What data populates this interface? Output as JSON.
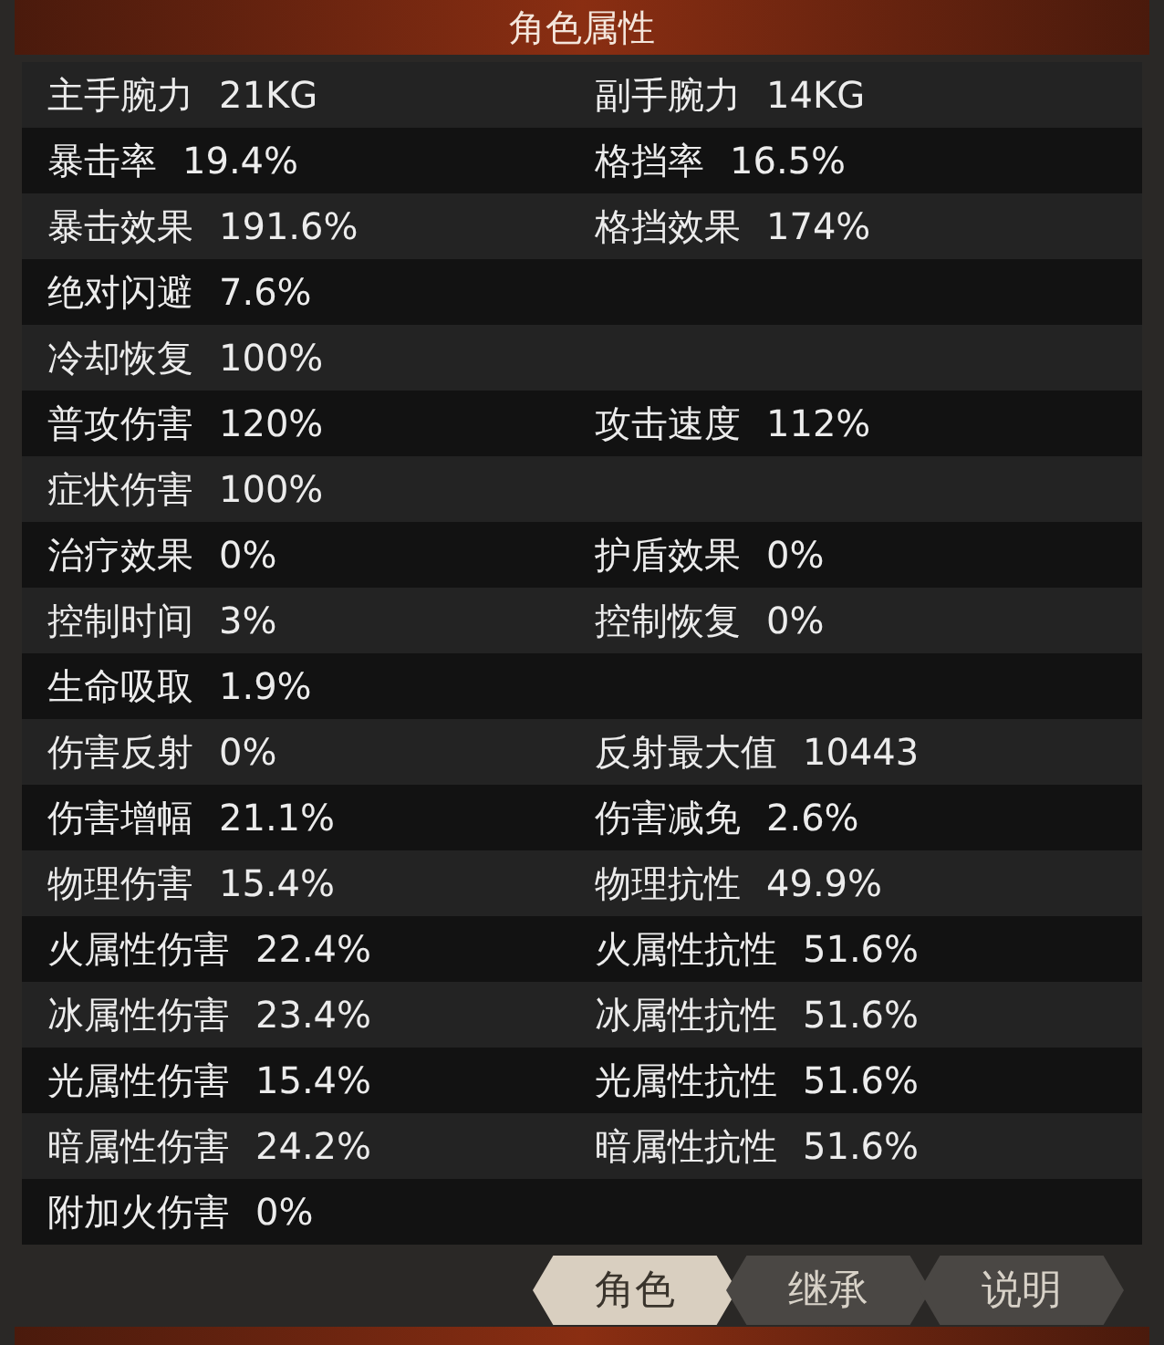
{
  "title": "角色属性",
  "rows": [
    {
      "left": {
        "label": "主手腕力",
        "value": "21KG"
      },
      "right": {
        "label": "副手腕力",
        "value": "14KG"
      }
    },
    {
      "left": {
        "label": "暴击率",
        "value": "19.4%"
      },
      "right": {
        "label": "格挡率",
        "value": "16.5%"
      }
    },
    {
      "left": {
        "label": "暴击效果",
        "value": "191.6%"
      },
      "right": {
        "label": "格挡效果",
        "value": "174%"
      }
    },
    {
      "left": {
        "label": "绝对闪避",
        "value": "7.6%"
      }
    },
    {
      "left": {
        "label": "冷却恢复",
        "value": "100%"
      }
    },
    {
      "left": {
        "label": "普攻伤害",
        "value": "120%"
      },
      "right": {
        "label": "攻击速度",
        "value": "112%"
      }
    },
    {
      "left": {
        "label": "症状伤害",
        "value": "100%"
      }
    },
    {
      "left": {
        "label": "治疗效果",
        "value": "0%"
      },
      "right": {
        "label": "护盾效果",
        "value": "0%"
      }
    },
    {
      "left": {
        "label": "控制时间",
        "value": "3%"
      },
      "right": {
        "label": "控制恢复",
        "value": "0%"
      }
    },
    {
      "left": {
        "label": "生命吸取",
        "value": "1.9%"
      }
    },
    {
      "left": {
        "label": "伤害反射",
        "value": "0%"
      },
      "right": {
        "label": "反射最大值",
        "value": "10443"
      }
    },
    {
      "left": {
        "label": "伤害增幅",
        "value": "21.1%"
      },
      "right": {
        "label": "伤害减免",
        "value": "2.6%"
      }
    },
    {
      "left": {
        "label": "物理伤害",
        "value": "15.4%"
      },
      "right": {
        "label": "物理抗性",
        "value": "49.9%"
      }
    },
    {
      "left": {
        "label": "火属性伤害",
        "value": "22.4%"
      },
      "right": {
        "label": "火属性抗性",
        "value": "51.6%"
      }
    },
    {
      "left": {
        "label": "冰属性伤害",
        "value": "23.4%"
      },
      "right": {
        "label": "冰属性抗性",
        "value": "51.6%"
      }
    },
    {
      "left": {
        "label": "光属性伤害",
        "value": "15.4%"
      },
      "right": {
        "label": "光属性抗性",
        "value": "51.6%"
      }
    },
    {
      "left": {
        "label": "暗属性伤害",
        "value": "24.2%"
      },
      "right": {
        "label": "暗属性抗性",
        "value": "51.6%"
      }
    },
    {
      "left": {
        "label": "附加火伤害",
        "value": "0%"
      }
    }
  ],
  "tabs": [
    {
      "label": "角色",
      "selected": true
    },
    {
      "label": "继承",
      "selected": false
    },
    {
      "label": "说明",
      "selected": false
    }
  ]
}
